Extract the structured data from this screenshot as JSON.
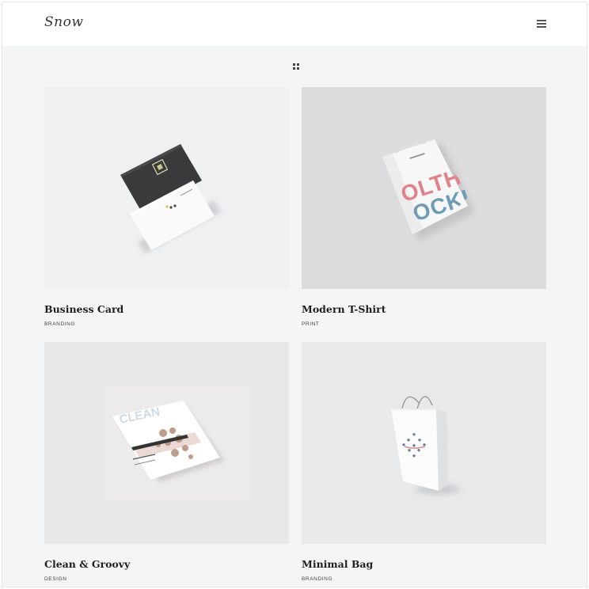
{
  "brand": {
    "logo_text": "Snow"
  },
  "header": {
    "menu_icon": "hamburger-icon"
  },
  "toolbar": {
    "grid_icon": "grid-icon"
  },
  "portfolio": {
    "items": [
      {
        "title": "Business Card",
        "category": "BRANDING",
        "image": "business-card-mockup",
        "background": "#eff0f2"
      },
      {
        "title": "Modern T-Shirt",
        "category": "PRINT",
        "image": "t-shirt-mockup",
        "background": "#dcdcde"
      },
      {
        "title": "Clean & Groovy",
        "category": "DESIGN",
        "image": "magazine-mockup",
        "background": "#e9e8e8"
      },
      {
        "title": "Minimal Bag",
        "category": "BRANDING",
        "image": "shopping-bag-mockup",
        "background": "#e8e9eb"
      }
    ]
  },
  "mockup_text": {
    "tshirt_line1": "OLTHIN",
    "tshirt_line2": "IOCKUP",
    "magazine_title": "CLEAN"
  }
}
